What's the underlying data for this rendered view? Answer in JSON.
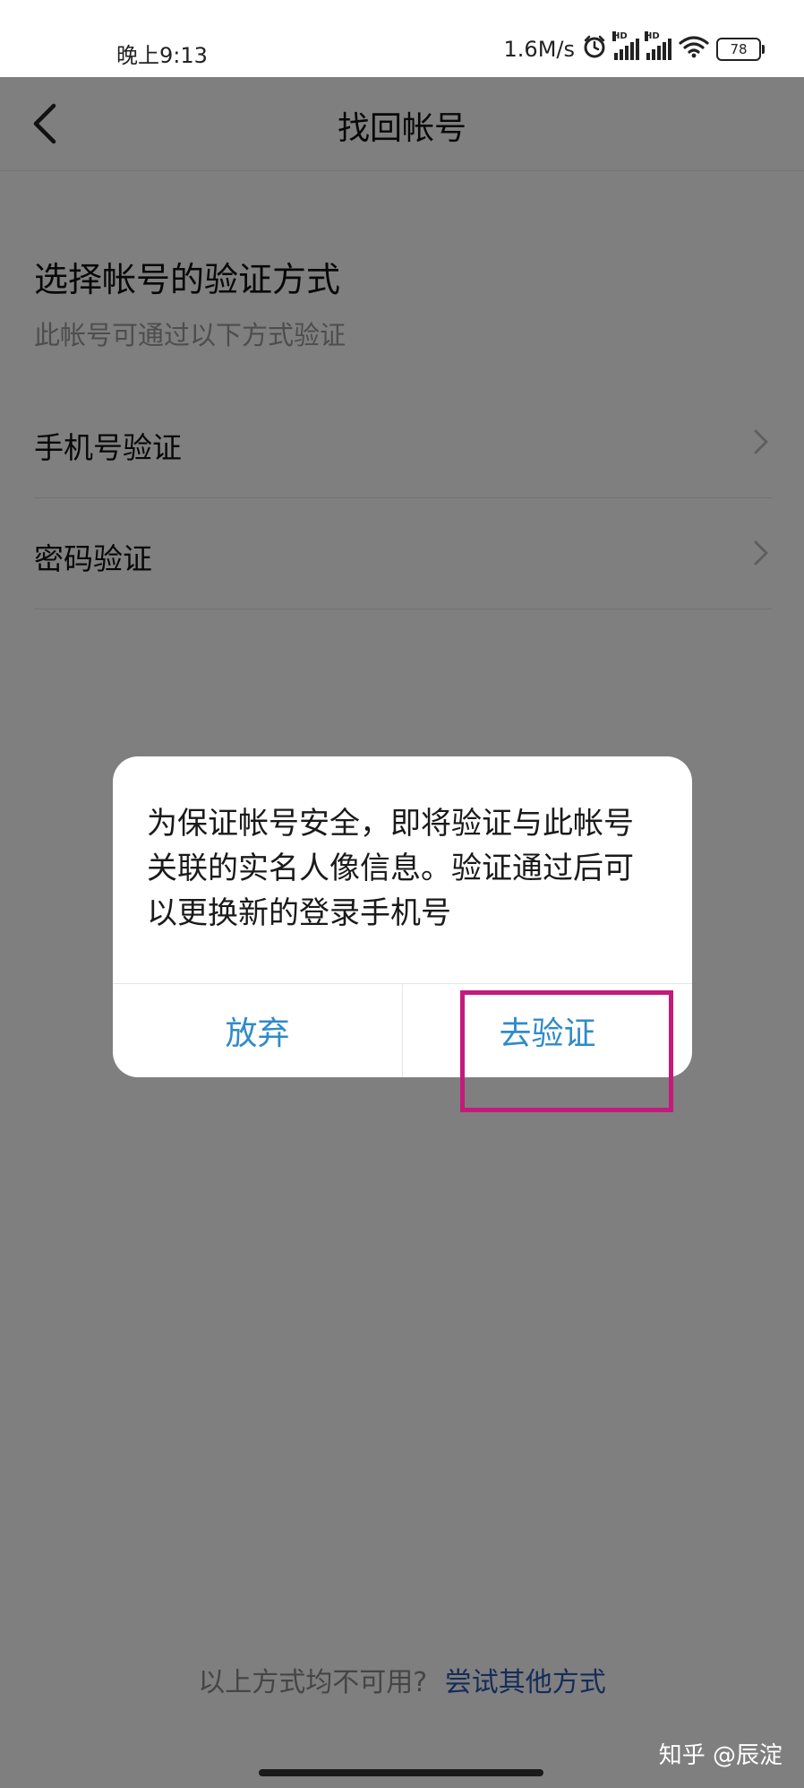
{
  "status_bar": {
    "time": "晚上9:13",
    "net_speed": "1.6M/s",
    "hd_label": "HD",
    "battery": "78",
    "icons": [
      "alarm-icon",
      "signal-icon",
      "signal-icon",
      "wifi-icon",
      "battery-icon"
    ]
  },
  "header": {
    "title": "找回帐号",
    "back_icon": "chevron-left-icon"
  },
  "section": {
    "title": "选择帐号的验证方式",
    "subtitle": "此帐号可通过以下方式验证"
  },
  "options": [
    {
      "label": "手机号验证",
      "icon": "chevron-right-icon"
    },
    {
      "label": "密码验证",
      "icon": "chevron-right-icon"
    }
  ],
  "footer": {
    "question": "以上方式均不可用?",
    "link": "尝试其他方式"
  },
  "dialog": {
    "message": "为保证帐号安全，即将验证与此帐号关联的实名人像信息。验证通过后可以更换新的登录手机号",
    "cancel_label": "放弃",
    "confirm_label": "去验证"
  },
  "watermark": "知乎 @辰淀",
  "colors": {
    "accent": "#2f8bc9",
    "link": "#2a58b0",
    "highlight_box": "#c41a7c",
    "overlay": "rgba(0,0,0,0.5)"
  }
}
